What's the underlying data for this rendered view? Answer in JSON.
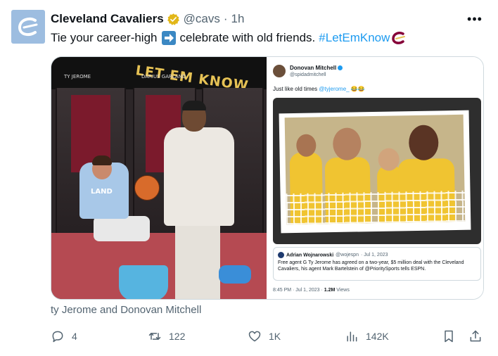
{
  "tweet": {
    "author_name": "Cleveland Cavaliers",
    "handle": "@cavs",
    "separator": "·",
    "time": "1h",
    "text_part1": "Tie your career-high",
    "text_part2": "celebrate with old friends.",
    "hashtag": "#LetEmKnow",
    "more_label": "•••"
  },
  "media": {
    "left_photo": {
      "banner_text": "LET EM KNOW.",
      "nameplate_1": "TY JEROME",
      "nameplate_2": "DARIUS GARLAND",
      "jersey_text": "LAND"
    },
    "embedded_post": {
      "author_name": "Donovan Mitchell",
      "author_handle": "@spidadmitchell",
      "text": "Just like old times",
      "mention": "@tyjerome_",
      "emoji": "😂😂",
      "quote": {
        "author_name": "Adrian Wojnarowski",
        "author_handle": "@wojespn",
        "date": "· Jul 1, 2023",
        "body": "Free agent G Ty Jerome has agreed on a two-year, $5 million deal with the Cleveland Cavaliers, his agent Mark Bartelstein of @PrioritySports tells ESPN."
      },
      "footer_time": "8:45 PM · Jul 1, 2023 ·",
      "footer_views": "1.2M",
      "footer_views_label": "Views"
    }
  },
  "caption": "ty Jerome and Donovan Mitchell",
  "actions": {
    "replies": "4",
    "reposts": "122",
    "likes": "1K",
    "views": "142K"
  },
  "colors": {
    "accent": "#1d9bf0",
    "muted": "#536471",
    "cavs_wine": "#860038",
    "cavs_gold": "#e6c255"
  }
}
